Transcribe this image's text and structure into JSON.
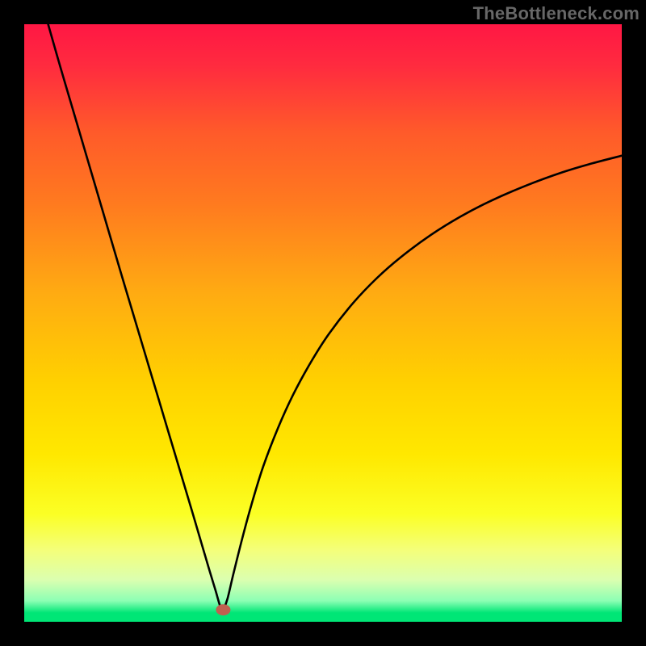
{
  "watermark": "TheBottleneck.com",
  "chart_data": {
    "type": "line",
    "title": "",
    "xlabel": "",
    "ylabel": "",
    "xlim": [
      0,
      100
    ],
    "ylim": [
      0,
      100
    ],
    "grid": false,
    "legend": false,
    "gradient_stops": [
      {
        "offset": 0.0,
        "color": "#ff1744"
      },
      {
        "offset": 0.07,
        "color": "#ff2b3f"
      },
      {
        "offset": 0.18,
        "color": "#ff5a2a"
      },
      {
        "offset": 0.3,
        "color": "#ff7a1f"
      },
      {
        "offset": 0.45,
        "color": "#ffab12"
      },
      {
        "offset": 0.6,
        "color": "#ffd100"
      },
      {
        "offset": 0.72,
        "color": "#ffe800"
      },
      {
        "offset": 0.82,
        "color": "#fbff25"
      },
      {
        "offset": 0.88,
        "color": "#f4ff7a"
      },
      {
        "offset": 0.93,
        "color": "#dbffb0"
      },
      {
        "offset": 0.965,
        "color": "#8cffb4"
      },
      {
        "offset": 0.985,
        "color": "#00e676"
      },
      {
        "offset": 1.0,
        "color": "#00e676"
      }
    ],
    "minimum_marker": {
      "x": 33.3,
      "y": 2.0,
      "color": "#c06050"
    },
    "series": [
      {
        "name": "left-branch",
        "x": [
          4.0,
          6.0,
          8.0,
          10.0,
          12.0,
          14.0,
          16.0,
          18.0,
          20.0,
          22.0,
          24.0,
          26.0,
          28.0,
          30.0,
          31.0,
          32.0,
          32.8,
          33.3
        ],
        "y": [
          100.0,
          93.0,
          86.2,
          79.4,
          72.6,
          65.8,
          59.0,
          52.3,
          45.6,
          38.9,
          32.2,
          25.5,
          18.8,
          12.0,
          8.6,
          5.3,
          2.6,
          2.0
        ]
      },
      {
        "name": "right-branch",
        "x": [
          33.3,
          34.0,
          35.0,
          36.5,
          38.0,
          40.0,
          42.5,
          45.0,
          48.0,
          51.0,
          55.0,
          59.0,
          63.0,
          68.0,
          73.0,
          78.0,
          84.0,
          90.0,
          95.0,
          100.0
        ],
        "y": [
          2.0,
          3.8,
          8.0,
          14.0,
          19.5,
          26.0,
          32.5,
          38.0,
          43.5,
          48.2,
          53.3,
          57.5,
          61.0,
          64.7,
          67.8,
          70.4,
          73.0,
          75.2,
          76.7,
          78.0
        ]
      }
    ]
  }
}
